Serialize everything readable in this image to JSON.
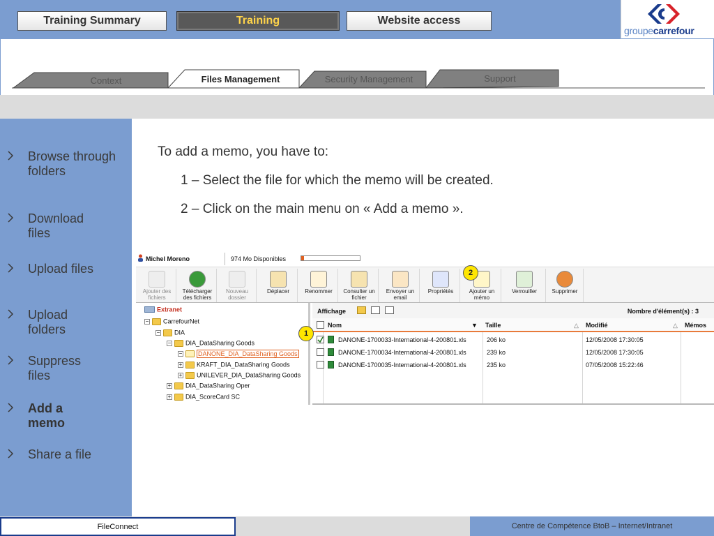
{
  "header": {
    "tabs": [
      {
        "label": "Training Summary",
        "active": false
      },
      {
        "label": "Training",
        "active": true
      },
      {
        "label": "Website access",
        "active": false
      }
    ],
    "logo_prefix": "groupe",
    "logo_brand": "carrefour"
  },
  "subnav": {
    "tabs": [
      {
        "label": "Context",
        "active": false
      },
      {
        "label": "Files Management",
        "active": true
      },
      {
        "label": "Security Management",
        "active": false
      },
      {
        "label": "Support",
        "active": false
      }
    ]
  },
  "sidebar": {
    "items": [
      {
        "label": "Browse through folders",
        "active": false
      },
      {
        "label": "Download files",
        "active": false
      },
      {
        "label": "Upload files",
        "active": false
      },
      {
        "label": "Upload folders",
        "active": false
      },
      {
        "label": "Suppress files",
        "active": false
      },
      {
        "label": "Add a memo",
        "active": true
      },
      {
        "label": "Share a file",
        "active": false
      }
    ]
  },
  "content": {
    "intro": "To add a memo, you have to:",
    "step1": "1 – Select the file for which the memo will be created.",
    "step2": "2 – Click on the main menu on « Add a memo »."
  },
  "app": {
    "user": "Michel Moreno",
    "quota": "974 Mo Disponibles",
    "toolbar": [
      {
        "label": "Ajouter des fichiers",
        "icon": "add-files-icon",
        "enabled": false
      },
      {
        "label": "Télécharger des fichiers",
        "icon": "download-icon",
        "enabled": true
      },
      {
        "label": "Nouveau dossier",
        "icon": "new-folder-icon",
        "enabled": false
      },
      {
        "label": "Déplacer",
        "icon": "move-icon",
        "enabled": true
      },
      {
        "label": "Renommer",
        "icon": "rename-icon",
        "enabled": true
      },
      {
        "label": "Consulter un fichier",
        "icon": "view-file-icon",
        "enabled": true
      },
      {
        "label": "Envoyer un email",
        "icon": "email-icon",
        "enabled": true
      },
      {
        "label": "Propriétés",
        "icon": "properties-icon",
        "enabled": true
      },
      {
        "label": "Ajouter un mémo",
        "icon": "add-memo-icon",
        "enabled": true
      },
      {
        "label": "Verrouiller",
        "icon": "lock-icon",
        "enabled": true
      },
      {
        "label": "Supprimer",
        "icon": "delete-icon",
        "enabled": true
      }
    ],
    "tree": [
      {
        "label": "Extranet",
        "level": 0,
        "root": true
      },
      {
        "label": "CarrefourNet",
        "level": 1
      },
      {
        "label": "DIA",
        "level": 2
      },
      {
        "label": "DIA_DataSharing Goods",
        "level": 3
      },
      {
        "label": "DANONE_DIA_DataSharing Goods",
        "level": 4,
        "selected": true
      },
      {
        "label": "KRAFT_DIA_DataSharing Goods",
        "level": 4
      },
      {
        "label": "UNILEVER_DIA_DataSharing Goods",
        "level": 4
      },
      {
        "label": "DIA_DataSharing Oper",
        "level": 3
      },
      {
        "label": "DIA_ScoreCard SC",
        "level": 3
      }
    ],
    "view_label": "Affichage",
    "count_label": "Nombre d'élément(s) : 3",
    "columns": {
      "name": "Nom",
      "size": "Taille",
      "modified": "Modifié",
      "memos": "Mémos"
    },
    "files": [
      {
        "name": "DANONE-1700033-International-4-200801.xls",
        "size": "206 ko",
        "modified": "12/05/2008 17:30:05",
        "checked": true
      },
      {
        "name": "DANONE-1700034-International-4-200801.xls",
        "size": "239 ko",
        "modified": "12/05/2008 17:30:05",
        "checked": false
      },
      {
        "name": "DANONE-1700035-International-4-200801.xls",
        "size": "235 ko",
        "modified": "07/05/2008 15:22:46",
        "checked": false
      }
    ],
    "markers": [
      "1",
      "2"
    ]
  },
  "footer": {
    "left": "FileConnect",
    "right": "Centre de Compétence BtoB – Internet/Intranet"
  },
  "colors": {
    "brand_blue": "#7b9dd0",
    "active_tab_bg": "#595959",
    "active_tab_text": "#ffd44a",
    "selection_orange": "#e06020"
  }
}
